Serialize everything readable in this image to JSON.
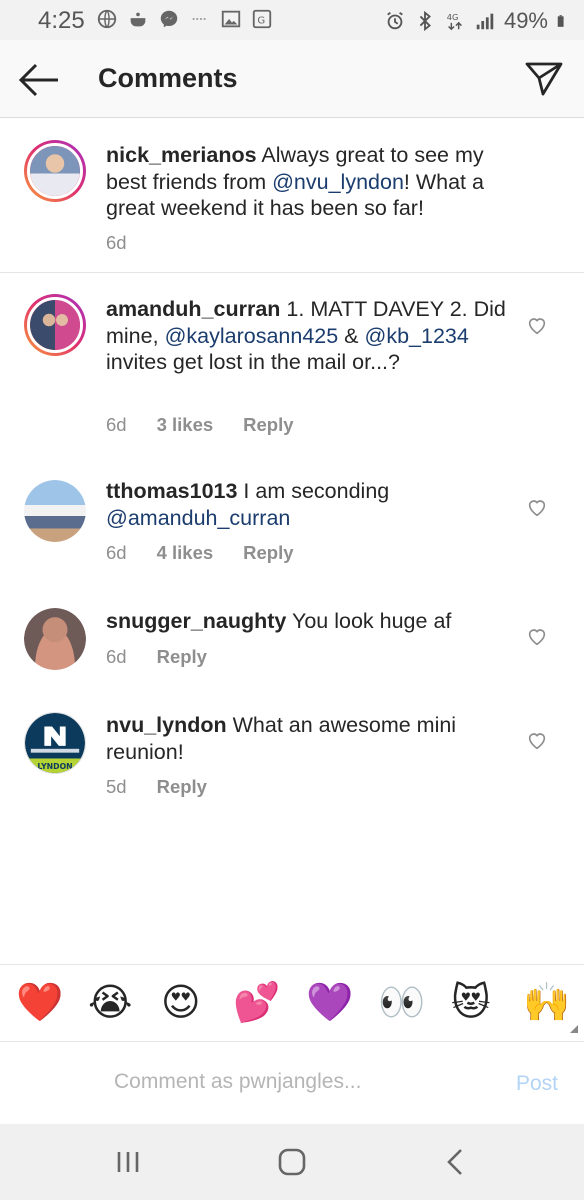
{
  "status_bar": {
    "time": "4:25",
    "battery": "49%",
    "network": "4G",
    "left_icons": [
      "globe-icon",
      "cooking-pot-icon",
      "messenger-icon",
      "dash-icon",
      "image-icon",
      "maps-icon"
    ],
    "right_icons": [
      "alarm-icon",
      "bluetooth-icon",
      "network-4g-icon",
      "signal-icon",
      "battery-icon"
    ]
  },
  "header": {
    "title": "Comments",
    "back_icon": "arrow-left-icon",
    "send_icon": "paper-plane-icon"
  },
  "comments": [
    {
      "username": "nick_merianos",
      "text_before": " Always great to see my best friends from ",
      "mention": "@nvu_lyndon",
      "text_after": "! What a great weekend it has been so far!",
      "time": "6d",
      "likes": "",
      "reply": "",
      "avatar_story_ring": true,
      "has_heart": false
    },
    {
      "username": "amanduh_curran",
      "text_1": " 1. MATT DAVEY 2. Did mine, ",
      "mention_1": "@kaylarosann425",
      "text_2": " & ",
      "mention_2": "@kb_1234",
      "text_3": " invites get lost in the mail or...?",
      "time": "6d",
      "likes": "3 likes",
      "reply": "Reply",
      "avatar_story_ring": true,
      "has_heart": true
    },
    {
      "username": "tthomas1013",
      "text_before": " I am seconding ",
      "mention": "@amanduh_curran",
      "time": "6d",
      "likes": "4 likes",
      "reply": "Reply",
      "has_heart": true
    },
    {
      "username": "snugger_naughty",
      "text_before": " You look huge af",
      "time": "6d",
      "reply": "Reply",
      "has_heart": true
    },
    {
      "username": "nvu_lyndon",
      "text_before": " What an awesome mini reunion!",
      "time": "5d",
      "reply": "Reply",
      "has_heart": true,
      "logo_text": "LYNDON"
    }
  ],
  "emoji_bar": [
    "❤️",
    "😭",
    "😍",
    "💕",
    "💜",
    "👀",
    "😻",
    "🙌"
  ],
  "composer": {
    "placeholder": "Comment as pwnjangles...",
    "post_label": "Post"
  },
  "nav_bar": {
    "icons": [
      "recent-apps-icon",
      "home-icon",
      "back-icon"
    ]
  },
  "colors": {
    "mention": "#1b3d6e",
    "meta": "#8e8e8e",
    "post_disabled": "#b3d4f5",
    "ring_start": "#f9a13a",
    "ring_end": "#a530c4"
  }
}
